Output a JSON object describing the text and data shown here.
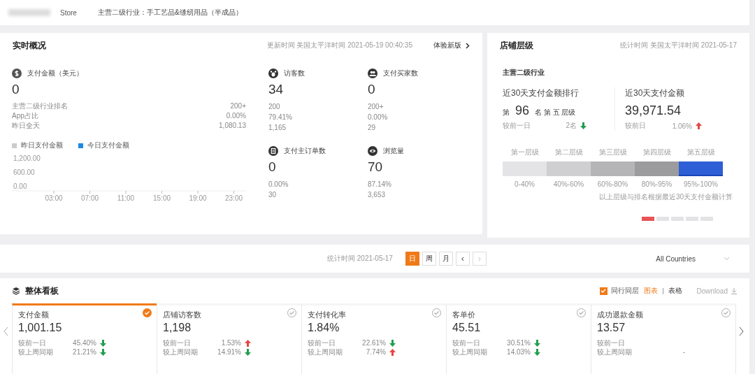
{
  "header": {
    "store_suffix": "Store",
    "industry": "主营二级行业：手工艺品&缝纫用品（半成品）"
  },
  "realtime": {
    "title": "实时概况",
    "updated": "更新时间 美国太平洋时间 2021-05-19 00:40:35",
    "new_version_link": "体验新版",
    "main_metric": {
      "label": "支付金额（美元）",
      "value": "0",
      "rows": [
        {
          "label": "主营二级行业排名",
          "value": "200+"
        },
        {
          "label": "App占比",
          "value": "0.00%"
        },
        {
          "label": "昨日全天",
          "value": "1,080.13"
        }
      ]
    },
    "metrics": [
      {
        "label": "访客数",
        "value": "34",
        "lines": [
          "200",
          "79.41%",
          "1,165"
        ]
      },
      {
        "label": "支付买家数",
        "value": "0",
        "lines": [
          "200+",
          "0.00%",
          "29"
        ]
      },
      {
        "label": "支付主订单数",
        "value": "0",
        "lines": [
          "0.00%",
          "30"
        ]
      },
      {
        "label": "浏览量",
        "value": "70",
        "lines": [
          "87.14%",
          "3,653"
        ]
      }
    ],
    "chart_data": {
      "type": "line",
      "categories": [
        "03:00",
        "07:00",
        "11:00",
        "15:00",
        "19:00",
        "23:00"
      ],
      "yticks": [
        {
          "value": 0,
          "label": "0.00"
        },
        {
          "value": 600,
          "label": "600.00"
        },
        {
          "value": 1200,
          "label": "1,200.00"
        }
      ],
      "ylim": [
        0,
        1200
      ],
      "series": [
        {
          "name": "昨日支付金额",
          "color": "#cccccc",
          "values": [
            null,
            null,
            null,
            null,
            null,
            null
          ]
        },
        {
          "name": "今日支付金额",
          "color": "#1e88e5",
          "values": [
            null,
            null,
            null,
            null,
            null,
            null
          ]
        }
      ]
    }
  },
  "tier": {
    "title": "店铺层级",
    "stat_time": "统计时间 美国太平洋时间 2021-05-17",
    "subtitle": "主营二级行业",
    "rank": {
      "label": "近30天支付金额排行",
      "prefix": "第",
      "number": "96",
      "suffix": "名 第 五 层级",
      "compare_label": "较前一日",
      "compare_value": "2名",
      "rising": false
    },
    "amount": {
      "label": "近30天支付金额",
      "value": "39,971.54",
      "compare_label": "较前日",
      "compare_value": "1.06%",
      "rising": true
    },
    "levels": [
      {
        "name": "第一层级",
        "range": "0-40%",
        "color": "#e4e4e6",
        "selected": false
      },
      {
        "name": "第二层级",
        "range": "40%-60%",
        "color": "#cfcfd1",
        "selected": false
      },
      {
        "name": "第三层级",
        "range": "60%-80%",
        "color": "#b5b5b7",
        "selected": false
      },
      {
        "name": "第四层级",
        "range": "80%-95%",
        "color": "#9c9c9e",
        "selected": false
      },
      {
        "name": "第五层级",
        "range": "95%-100%",
        "color": "#2f5fd6",
        "selected": true
      }
    ],
    "note": "以上层级与排名根据最近30天支付金额计算",
    "pager": [
      {
        "selected": true
      },
      {
        "selected": false
      },
      {
        "selected": false
      },
      {
        "selected": false
      },
      {
        "selected": false
      }
    ]
  },
  "filter": {
    "stat_time": "统计时间 2021-05-17",
    "periods": [
      {
        "label": "日",
        "selected": true
      },
      {
        "label": "周",
        "selected": false
      },
      {
        "label": "月",
        "selected": false
      }
    ],
    "prev": "‹",
    "next": "›",
    "next_disabled": true,
    "country": "All Countries"
  },
  "board": {
    "title": "整体看板",
    "peer_checkbox": {
      "label": "同行同层",
      "checked": true
    },
    "views": [
      {
        "label": "图表",
        "selected": true
      },
      {
        "label": "表格",
        "selected": false
      }
    ],
    "download": "Download",
    "cards": [
      {
        "label": "支付金额",
        "value": "1,001.15",
        "selected": true,
        "rows": [
          {
            "label": "较前一日",
            "value": "45.40%",
            "rising": false
          },
          {
            "label": "较上周同期",
            "value": "21.21%",
            "rising": false
          }
        ]
      },
      {
        "label": "店铺访客数",
        "value": "1,198",
        "selected": false,
        "rows": [
          {
            "label": "较前一日",
            "value": "1.53%",
            "rising": true
          },
          {
            "label": "较上周同期",
            "value": "14.91%",
            "rising": false
          }
        ]
      },
      {
        "label": "支付转化率",
        "value": "1.84%",
        "selected": false,
        "rows": [
          {
            "label": "较前一日",
            "value": "22.61%",
            "rising": false
          },
          {
            "label": "较上周同期",
            "value": "7.74%",
            "rising": true
          }
        ]
      },
      {
        "label": "客单价",
        "value": "45.51",
        "selected": false,
        "rows": [
          {
            "label": "较前一日",
            "value": "30.51%",
            "rising": false
          },
          {
            "label": "较上周同期",
            "value": "14.03%",
            "rising": false
          }
        ]
      },
      {
        "label": "成功退款金额",
        "value": "13.57",
        "selected": false,
        "rows": [
          {
            "label": "较前一日"
          },
          {
            "label": "较上周同期",
            "value": "-"
          }
        ]
      }
    ]
  }
}
